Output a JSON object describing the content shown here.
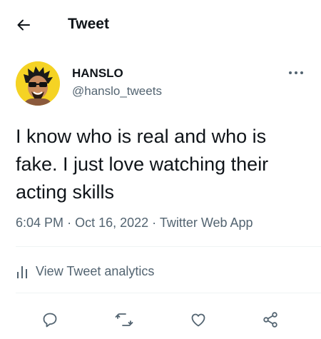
{
  "header": {
    "title": "Tweet",
    "back_icon": "arrow-left-icon"
  },
  "tweet": {
    "author": {
      "display_name": "HANSLO",
      "handle": "@hanslo_tweets",
      "avatar_bg": "#f5d324"
    },
    "text": "I know who is real and who is fake. I just love watching their acting skills",
    "timestamp": "6:04 PM",
    "date": "Oct 16, 2022",
    "source": "Twitter Web App",
    "separator": "·"
  },
  "analytics": {
    "label": "View Tweet analytics",
    "icon": "analytics-bars-icon"
  },
  "actions": [
    "reply-icon",
    "retweet-icon",
    "like-icon",
    "share-icon"
  ],
  "colors": {
    "text": "#0f1419",
    "secondary": "#536471",
    "divider": "#eff3f4"
  }
}
